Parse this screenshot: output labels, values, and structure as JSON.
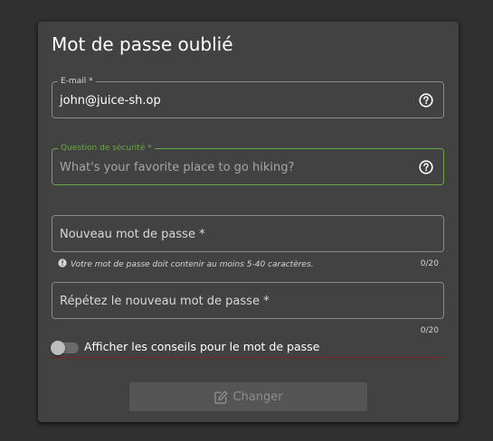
{
  "form": {
    "title": "Mot de passe oublié",
    "email": {
      "label": "E-mail *",
      "value": "john@juice-sh.op",
      "help_icon": "help-circle-icon"
    },
    "security_question": {
      "label": "Question de sécurité *",
      "placeholder": "What's your favorite place to go hiking?",
      "help_icon": "help-circle-icon"
    },
    "new_password": {
      "label": "Nouveau mot de passe *",
      "hint": "Votre mot de passe doit contenir au moins 5-40 caractères.",
      "hint_icon": "info-circle-icon",
      "counter": "0/20"
    },
    "repeat_password": {
      "label": "Répétez le nouveau mot de passe *",
      "counter": "0/20"
    },
    "show_tips": {
      "label": "Afficher les conseils pour le mot de passe",
      "checked": false
    },
    "submit": {
      "label": "Changer",
      "icon": "edit-icon",
      "disabled": true
    }
  },
  "colors": {
    "page_background": "#303030",
    "card_background": "#424242",
    "focus_accent": "#69a842",
    "warn_underline": "#7a2424"
  }
}
